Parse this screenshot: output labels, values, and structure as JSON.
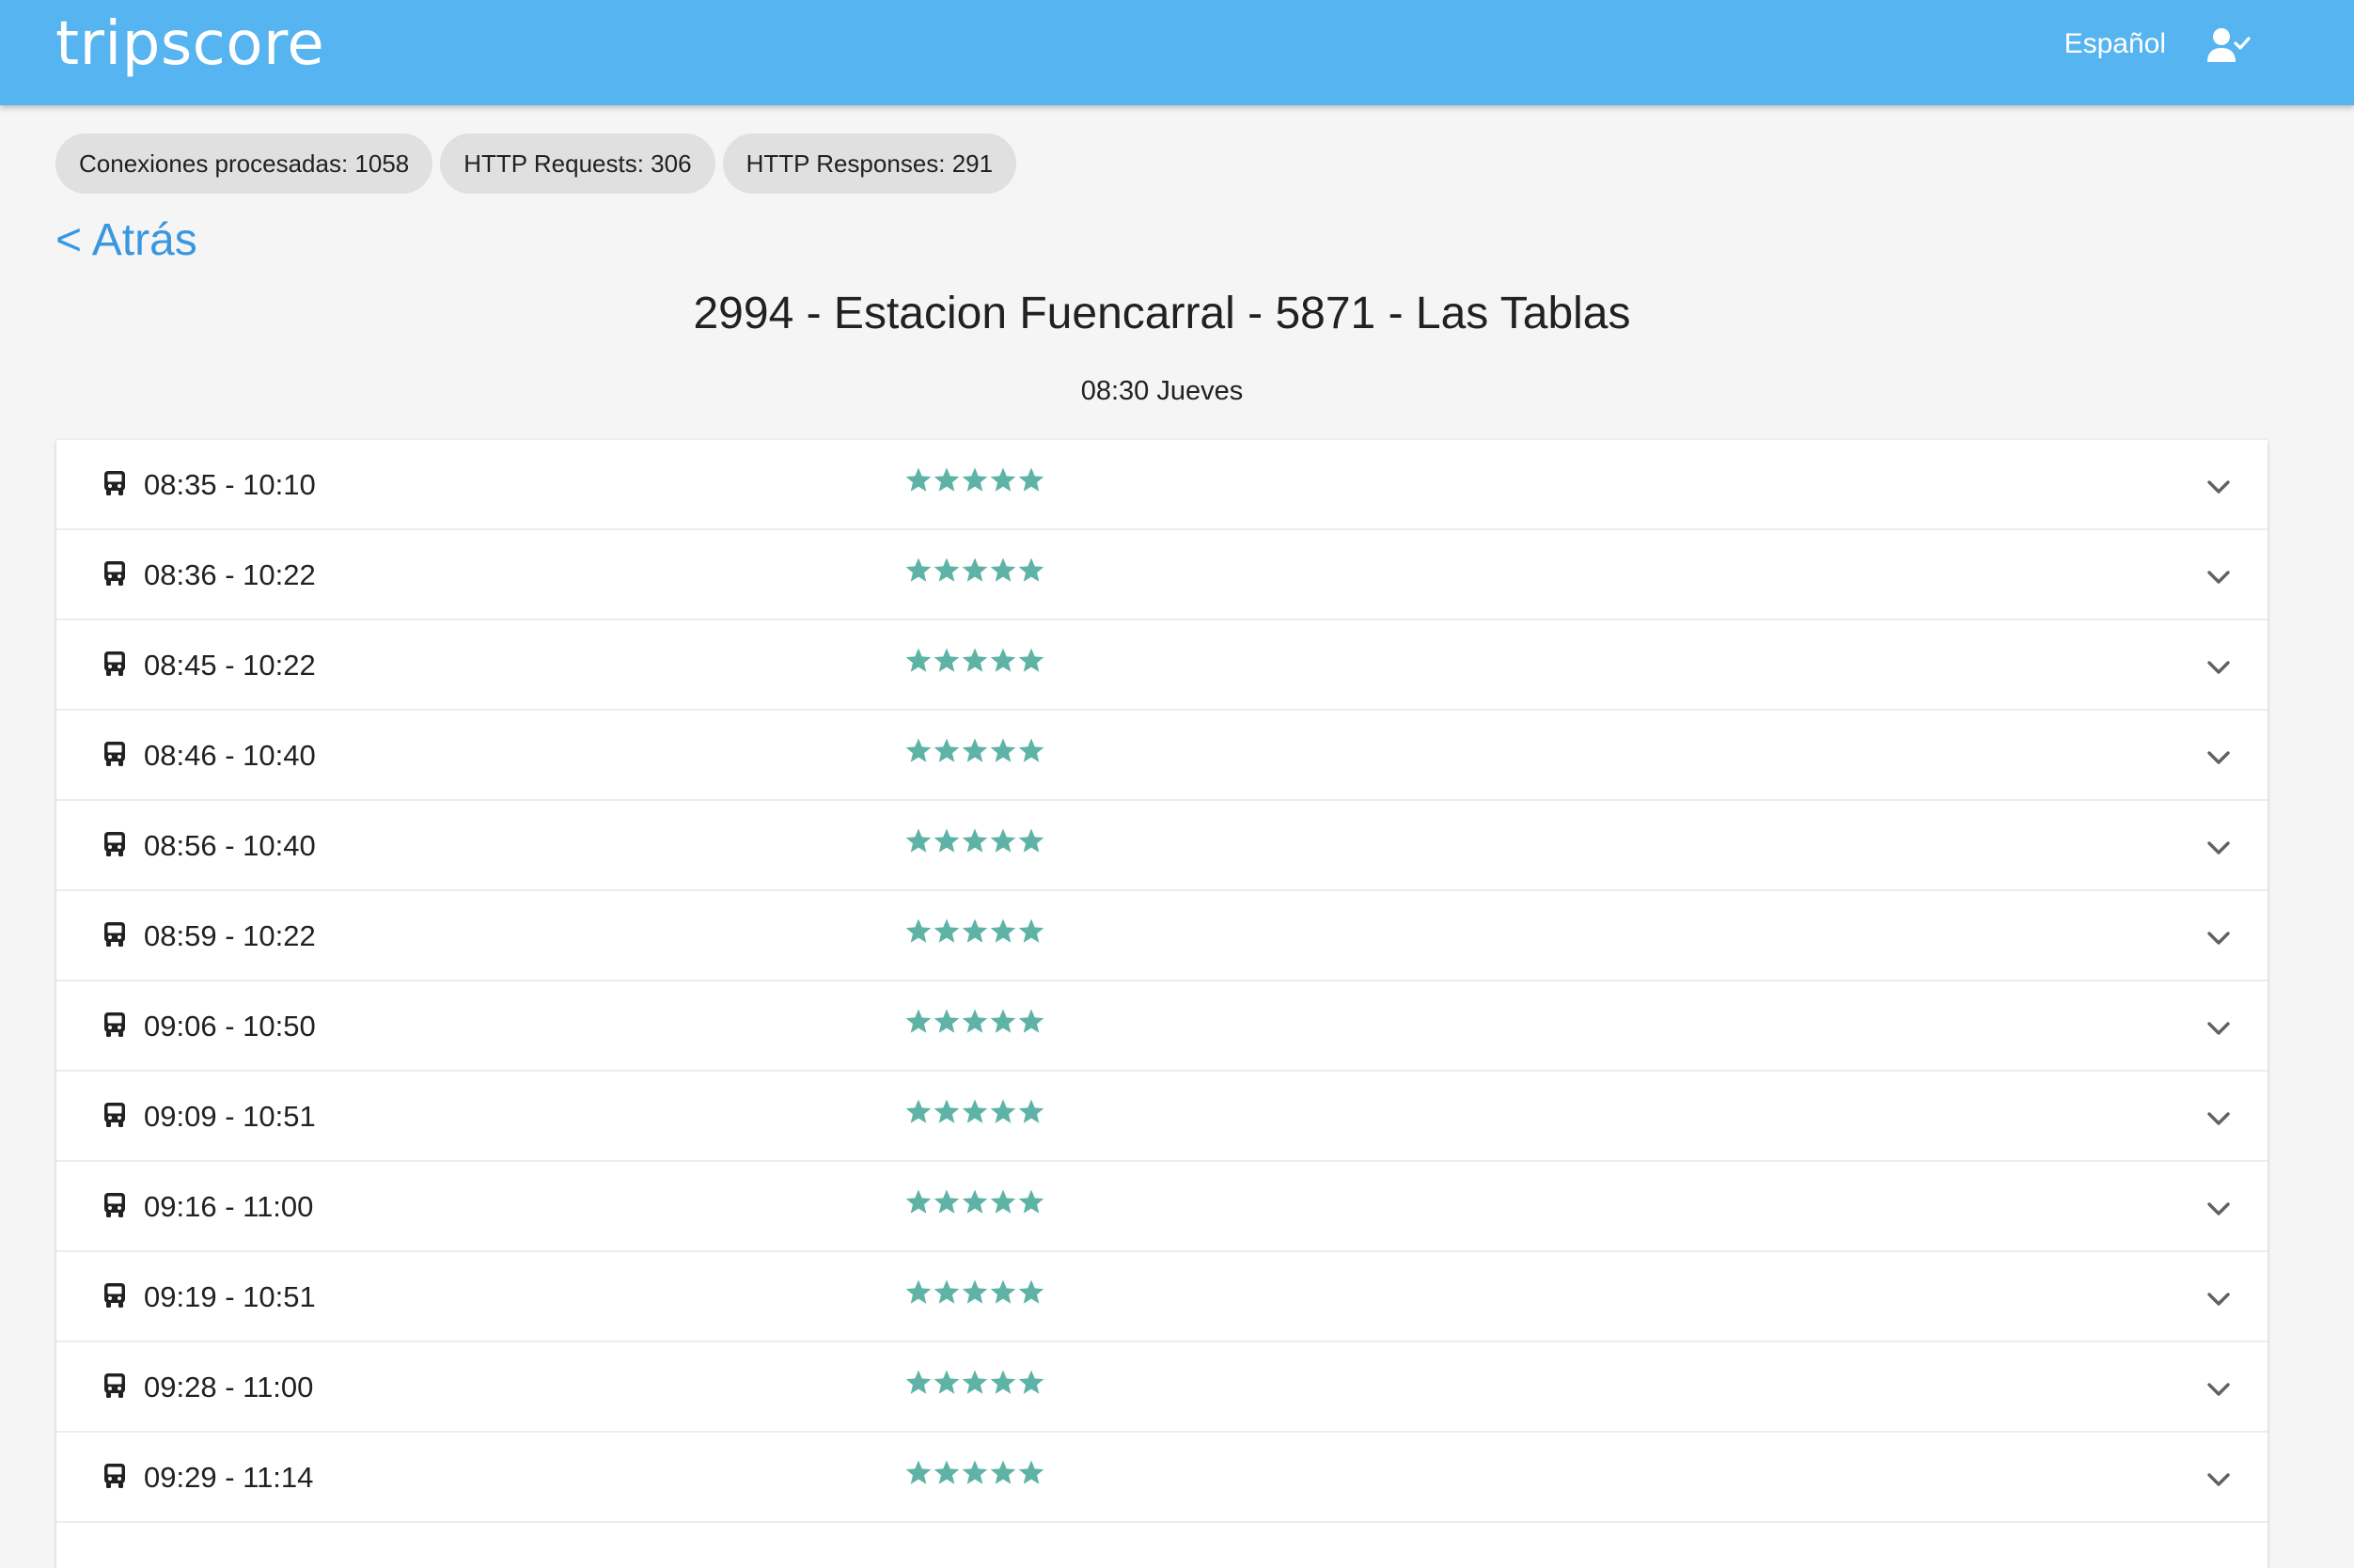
{
  "header": {
    "brand": "tripscore",
    "language": "Español",
    "user_icon": "person-check-icon",
    "color": "#56b4f0"
  },
  "stats": {
    "chips": [
      "Conexiones procesadas: 1058",
      "HTTP Requests: 306",
      "HTTP Responses: 291"
    ]
  },
  "nav": {
    "back_label": "< Atrás",
    "back_color": "#3a97de"
  },
  "page": {
    "title": "2994 - Estacion Fuencarral - 5871 - Las Tablas",
    "subtitle": "08:30 Jueves"
  },
  "trips": {
    "star_color": "#5fb3a6",
    "items": [
      {
        "time": "08:35 - 10:10",
        "rating": 5
      },
      {
        "time": "08:36 - 10:22",
        "rating": 5
      },
      {
        "time": "08:45 - 10:22",
        "rating": 5
      },
      {
        "time": "08:46 - 10:40",
        "rating": 5
      },
      {
        "time": "08:56 - 10:40",
        "rating": 5
      },
      {
        "time": "08:59 - 10:22",
        "rating": 5
      },
      {
        "time": "09:06 - 10:50",
        "rating": 5
      },
      {
        "time": "09:09 - 10:51",
        "rating": 5
      },
      {
        "time": "09:16 - 11:00",
        "rating": 5
      },
      {
        "time": "09:19 - 10:51",
        "rating": 5
      },
      {
        "time": "09:28 - 11:00",
        "rating": 5
      },
      {
        "time": "09:29 - 11:14",
        "rating": 5
      }
    ]
  }
}
